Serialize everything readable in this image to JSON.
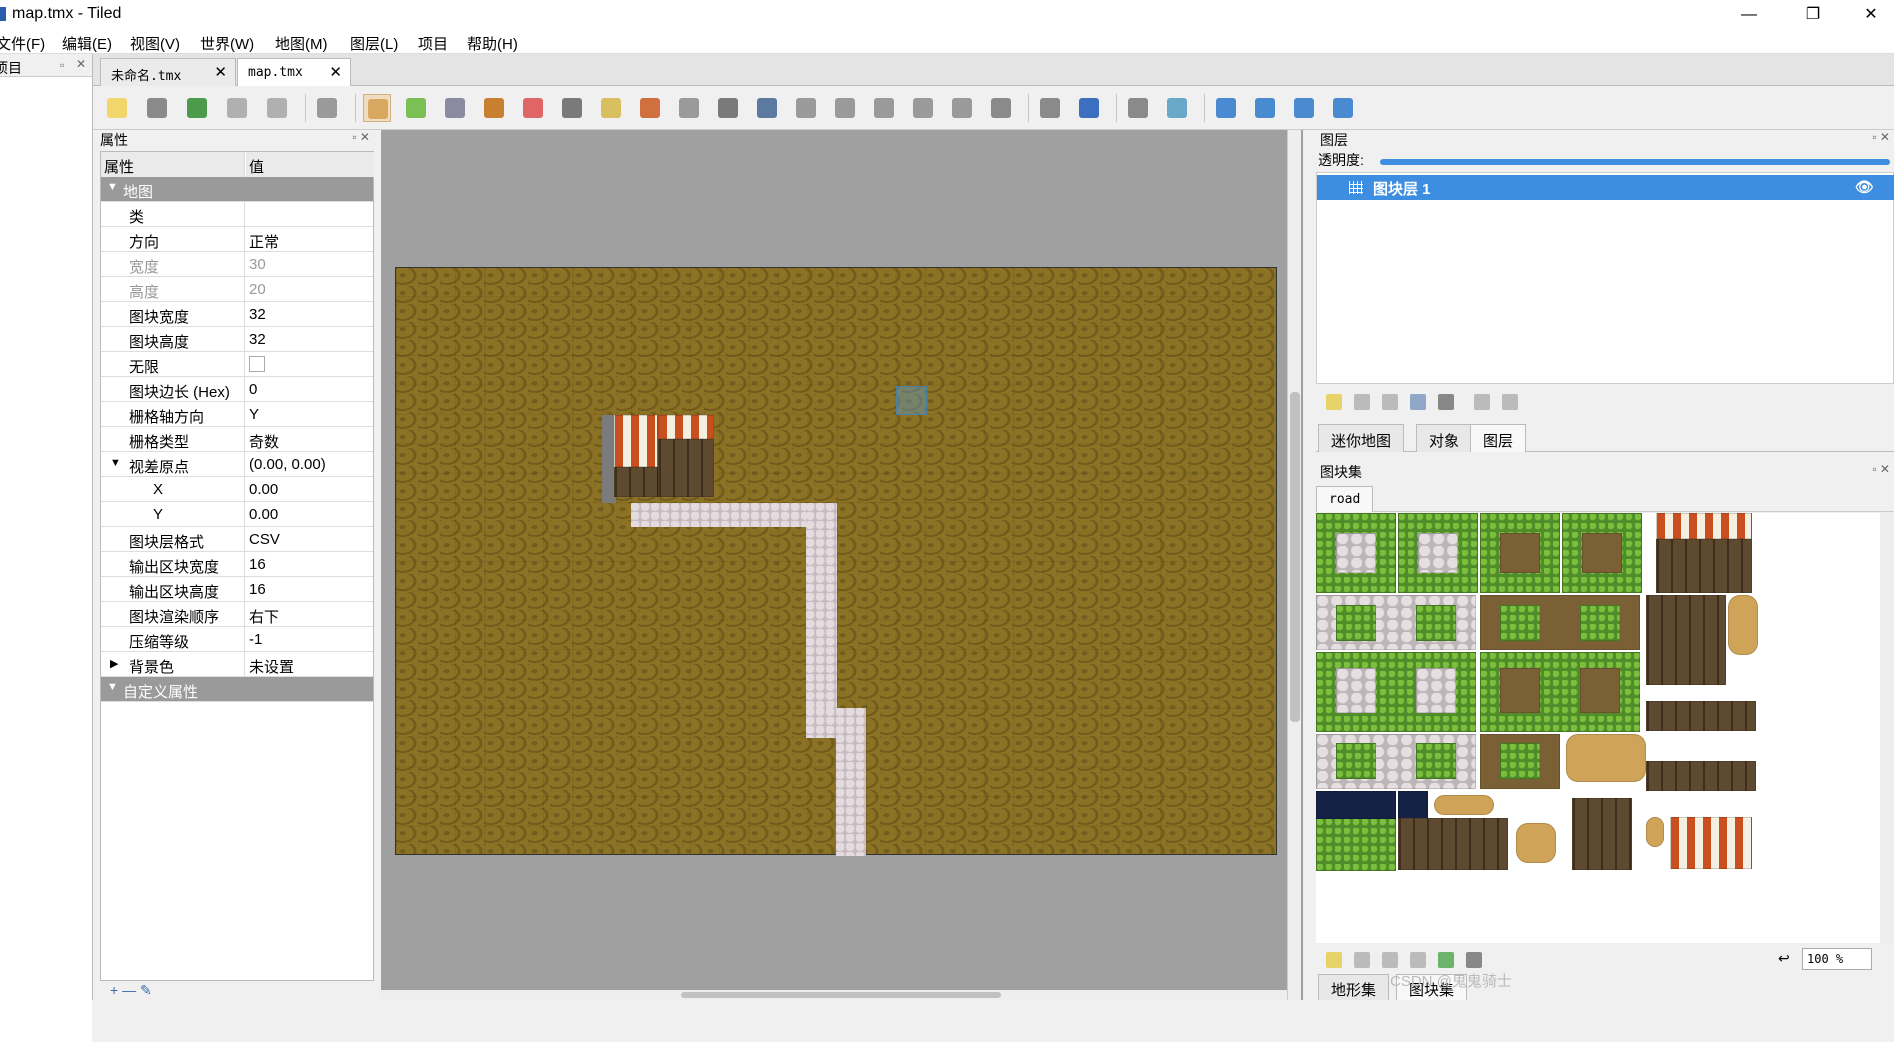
{
  "window": {
    "title": "map.tmx - Tiled",
    "minimize": "—",
    "maximize": "❐",
    "close": "✕"
  },
  "menu": [
    "文件(F)",
    "编辑(E)",
    "视图(V)",
    "世界(W)",
    "地图(M)",
    "图层(L)",
    "项目",
    "帮助(H)"
  ],
  "left_strip": {
    "title": "项目"
  },
  "doc_tabs": [
    {
      "label": "未命名.tmx",
      "active": false
    },
    {
      "label": "map.tmx",
      "active": true
    }
  ],
  "toolbar_icons": [
    "new-map-icon",
    "open-icon",
    "save-icon",
    "undo-icon",
    "redo-icon",
    "command-icon",
    "stamp-brush-icon",
    "terrain-brush-icon",
    "bucket-fill-icon",
    "shape-fill-icon",
    "eraser-icon",
    "rect-select-icon",
    "magic-wand-icon",
    "select-same-tile-icon",
    "select-objects-icon",
    "edit-polygons-icon",
    "insert-rect-icon",
    "insert-point-icon",
    "insert-ellipse-icon",
    "insert-polygon-icon",
    "insert-tile-icon",
    "insert-template-icon",
    "insert-text-icon",
    "world-tool-icon",
    "move-icon",
    "random-mode-icon",
    "wangfill-icon",
    "flip-h-icon",
    "flip-v-icon",
    "rotate-left-icon",
    "rotate-right-icon"
  ],
  "properties": {
    "title": "属性",
    "col_key": "属性",
    "col_value": "值",
    "groups": {
      "map": "地图",
      "custom": "自定义属性"
    },
    "rows": [
      {
        "key": "类",
        "value": ""
      },
      {
        "key": "方向",
        "value": "正常"
      },
      {
        "key": "宽度",
        "value": "30"
      },
      {
        "key": "高度",
        "value": "20"
      },
      {
        "key": "图块宽度",
        "value": "32"
      },
      {
        "key": "图块高度",
        "value": "32"
      },
      {
        "key": "无限",
        "value": ""
      },
      {
        "key": "图块边长 (Hex)",
        "value": "0"
      },
      {
        "key": "栅格轴方向",
        "value": "Y"
      },
      {
        "key": "栅格类型",
        "value": "奇数"
      },
      {
        "key": "视差原点",
        "value": "(0.00, 0.00)"
      },
      {
        "key": "X",
        "value": "0.00"
      },
      {
        "key": "Y",
        "value": "0.00"
      },
      {
        "key": "图块层格式",
        "value": "CSV"
      },
      {
        "key": "输出区块宽度",
        "value": "16"
      },
      {
        "key": "输出区块高度",
        "value": "16"
      },
      {
        "key": "图块渲染顺序",
        "value": "右下"
      },
      {
        "key": "压缩等级",
        "value": "-1"
      },
      {
        "key": "背景色",
        "value": "未设置"
      }
    ],
    "footer": "+ — ✎"
  },
  "layers": {
    "title": "图层",
    "opacity_label": "透明度:",
    "opacity": 1.0,
    "items": [
      {
        "name": "图块层 1",
        "selected": true,
        "visible": true
      }
    ],
    "tabs": [
      "迷你地图",
      "对象",
      "图层"
    ],
    "active_tab": "图层"
  },
  "tilesets": {
    "title": "图块集",
    "current": "road",
    "zoom": "100 %",
    "bottom_tabs": [
      "地形集",
      "图块集"
    ],
    "watermark": "CSDN @鬼鬼骑士"
  },
  "colors": {
    "accent": "#3d8ee0",
    "map_ground": "#8c7224",
    "road": "#c7bbc0",
    "canvas_bg": "#a0a0a0"
  }
}
